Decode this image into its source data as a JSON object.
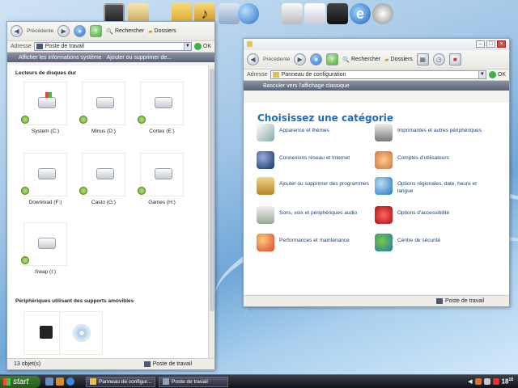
{
  "colors": {
    "accent": "#2f6fc4",
    "heading": "#1f6db5",
    "link": "#1d3f76"
  },
  "dock": {
    "items": [
      "monitor-icon",
      "briefcase-icon",
      "folder-icon",
      "music-folder-icon",
      "tools-icon",
      "globe-icon",
      "control-icon",
      "mail-icon",
      "film-icon",
      "ie-icon",
      "play-icon"
    ]
  },
  "left_window": {
    "toolbar": {
      "back": "Précédente",
      "search": "Rechercher",
      "folders": "Dossiers"
    },
    "address": {
      "label": "Adresse",
      "value": "Poste de travail",
      "go": "OK"
    },
    "tasks": {
      "show_info": "Afficher les informations système",
      "add_remove": "Ajouter ou supprimer de..."
    },
    "hard_drives_title": "Lecteurs de disques dur",
    "drives": [
      {
        "label": "System (C:)"
      },
      {
        "label": "Minus (D:)"
      },
      {
        "label": "Cortex (E:)"
      },
      {
        "label": "Download (F:)"
      },
      {
        "label": "Casto (G:)"
      },
      {
        "label": "Games (H:)"
      },
      {
        "label": "Swap (I:)"
      }
    ],
    "removable_title": "Périphériques utilisant des supports amovibles",
    "status": {
      "count": "13 objet(s)",
      "location": "Poste de travail"
    }
  },
  "right_window": {
    "toolbar": {
      "back": "Précédente",
      "search": "Rechercher",
      "folders": "Dossiers"
    },
    "address": {
      "label": "Adresse",
      "value": "Panneau de configuration",
      "go": "OK"
    },
    "switch_view": "Basculer vers l'affichage classique",
    "heading": "Choisissez une catégorie",
    "categories": [
      {
        "label": "Apparence et thèmes"
      },
      {
        "label": "Imprimantes et autres périphériques"
      },
      {
        "label": "Connexions réseau et Internet"
      },
      {
        "label": "Comptes d'utilisateurs"
      },
      {
        "label": "Ajouter ou supprimer des programmes"
      },
      {
        "label": "Options régionales, date, heure et langue"
      },
      {
        "label": "Sons, voix et périphériques audio"
      },
      {
        "label": "Options d'accessibilité"
      },
      {
        "label": "Performances et maintenance"
      },
      {
        "label": "Centre de sécurité"
      }
    ],
    "status": {
      "location": "Poste de travail"
    }
  },
  "taskbar": {
    "start": "start",
    "tasks": [
      "Panneau de configur...",
      "Poste de travail"
    ],
    "clock_h": "18",
    "clock_m": "18"
  }
}
